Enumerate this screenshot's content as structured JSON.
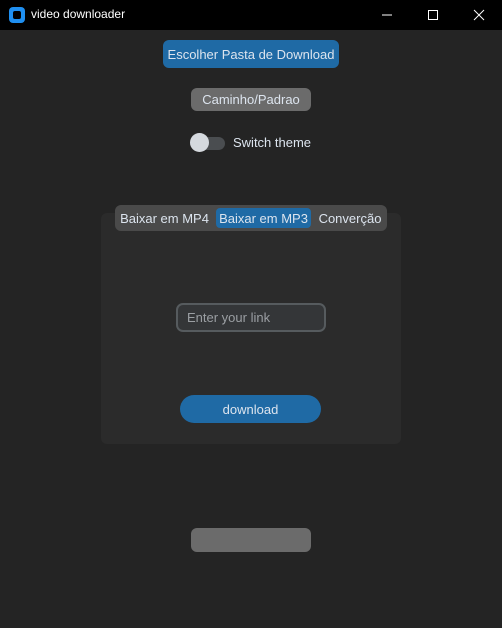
{
  "window": {
    "title": "video downloader",
    "icon": "app-icon",
    "controls": [
      "minimize-icon",
      "maximize-icon",
      "close-icon"
    ]
  },
  "toolbar": {
    "choose_folder_label": "Escolher Pasta de Download",
    "path_label": "Caminho/Padrao"
  },
  "theme_switch": {
    "label": "Switch theme",
    "on": false
  },
  "tabs": {
    "items": [
      "Baixar em MP4",
      "Baixar em MP3",
      "Converção"
    ],
    "selected": "Baixar em MP3"
  },
  "link_input": {
    "value": "",
    "placeholder": "Enter your link"
  },
  "download_button": {
    "label": "download"
  },
  "bottom_button": {
    "label": ""
  },
  "colors": {
    "background": "#242424",
    "accent": "#1f6aa5",
    "neutral_button": "#6b6b6b"
  }
}
